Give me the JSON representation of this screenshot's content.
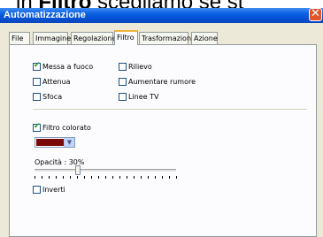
{
  "background_text": {
    "prefix": "in ",
    "bold": "Filtro",
    "rest": " scegliamo se st"
  },
  "window": {
    "title": "Automatizzazione",
    "close_glyph": "✕"
  },
  "tabs": [
    {
      "label": "File",
      "active": false
    },
    {
      "label": "Immagine",
      "active": false
    },
    {
      "label": "Regolazione",
      "active": false
    },
    {
      "label": "Filtro",
      "active": true
    },
    {
      "label": "Trasformazione",
      "active": false
    },
    {
      "label": "Azione",
      "active": false
    }
  ],
  "filters": [
    {
      "label": "Messa a fuoco",
      "checked": true
    },
    {
      "label": "Rilievo",
      "checked": false
    },
    {
      "label": "Attenua",
      "checked": false
    },
    {
      "label": "Aumentare rumore",
      "checked": false
    },
    {
      "label": "Sfoca",
      "checked": false
    },
    {
      "label": "Linee TV",
      "checked": false
    }
  ],
  "color_filter": {
    "label": "Filtro colorato",
    "checked": true,
    "color": "#7a0a0a",
    "dropdown_icon": "chevron-down-icon"
  },
  "opacity": {
    "label": "Opacità : 30%",
    "value": 30
  },
  "invert": {
    "label": "Inverti",
    "checked": false
  },
  "colors": {
    "titlebar": "#0a5fe0",
    "active_tab_accent": "#f0b43c",
    "check": "#21a121",
    "close": "#e0552c"
  }
}
